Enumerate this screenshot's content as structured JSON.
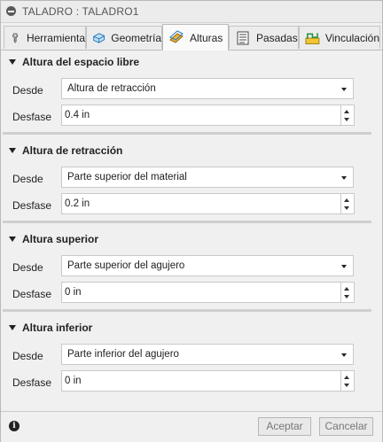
{
  "window": {
    "title": "TALADRO : TALADRO1"
  },
  "tabs": [
    {
      "label": "Herramienta",
      "icon": "tool-icon"
    },
    {
      "label": "Geometría",
      "icon": "geometry-icon"
    },
    {
      "label": "Alturas",
      "icon": "heights-icon",
      "active": true
    },
    {
      "label": "Pasadas",
      "icon": "passes-icon"
    },
    {
      "label": "Vinculación",
      "icon": "linking-icon"
    }
  ],
  "sections": [
    {
      "title": "Altura del espacio libre",
      "desde_label": "Desde",
      "desde_value": "Altura de retracción",
      "desfase_label": "Desfase",
      "desfase_value": "0.4 in"
    },
    {
      "title": "Altura de retracción",
      "desde_label": "Desde",
      "desde_value": "Parte superior del material",
      "desfase_label": "Desfase",
      "desfase_value": "0.2 in"
    },
    {
      "title": "Altura superior",
      "desde_label": "Desde",
      "desde_value": "Parte superior del agujero",
      "desfase_label": "Desfase",
      "desfase_value": "0 in"
    },
    {
      "title": "Altura inferior",
      "desde_label": "Desde",
      "desde_value": "Parte inferior del agujero",
      "desfase_label": "Desfase",
      "desfase_value": "0 in"
    }
  ],
  "footer": {
    "info_icon_glyph": "i",
    "accept_label": "Aceptar",
    "cancel_label": "Cancelar"
  }
}
